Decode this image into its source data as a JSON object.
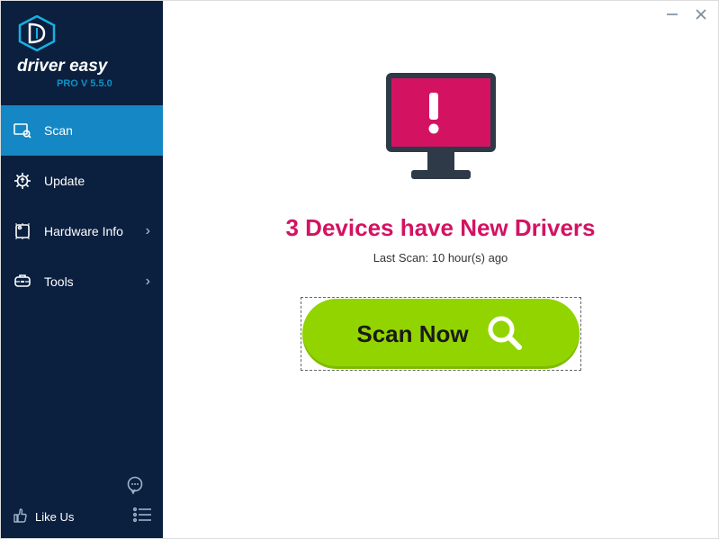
{
  "brand": {
    "name": "driver easy",
    "version": "PRO V 5.5.0"
  },
  "sidebar": {
    "items": [
      {
        "label": "Scan"
      },
      {
        "label": "Update"
      },
      {
        "label": "Hardware Info"
      },
      {
        "label": "Tools"
      }
    ],
    "likeus_label": "Like Us"
  },
  "main": {
    "headline": "3 Devices have New Drivers",
    "last_scan": "Last Scan: 10 hour(s) ago",
    "scan_button": "Scan Now"
  },
  "colors": {
    "accent_pink": "#d31362",
    "scan_green": "#92d400",
    "sidebar_active": "#1487c4"
  }
}
